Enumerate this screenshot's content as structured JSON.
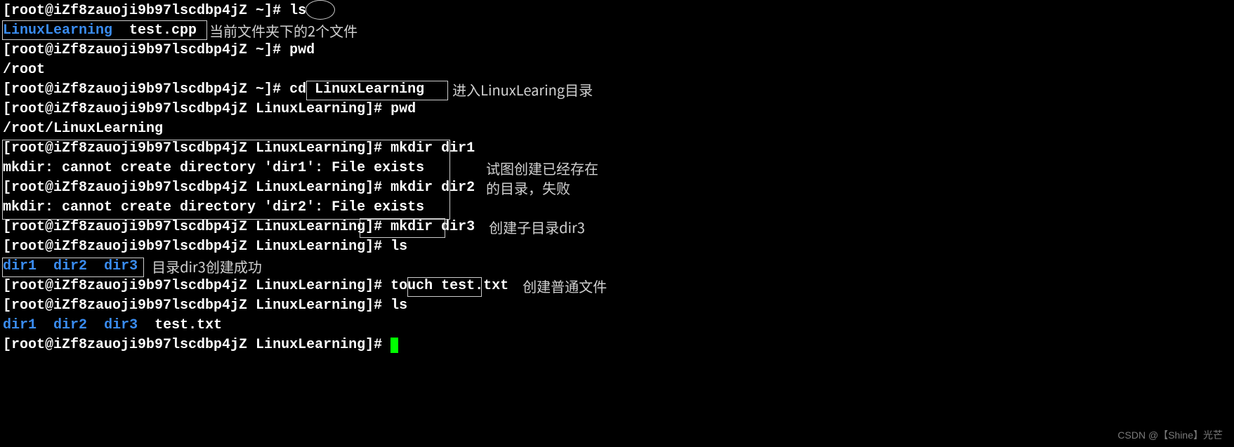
{
  "prompt_root": "[root@iZf8zauoji9b97lscdbp4jZ ~]# ",
  "prompt_linux": "[root@iZf8zauoji9b97lscdbp4jZ LinuxLearning]# ",
  "cmd_ls": "ls",
  "out_ls_dir": "LinuxLearning",
  "out_ls_file": "test.cpp",
  "annot_1": "当前文件夹下的2个文件",
  "cmd_pwd": "pwd",
  "out_pwd_root": "/root",
  "cmd_cd": "cd LinuxLearning",
  "annot_2": "进入LinuxLearing目录",
  "out_pwd_linux": "/root/LinuxLearning",
  "cmd_mkdir1": "mkdir dir1",
  "err_mkdir1": "mkdir: cannot create directory 'dir1': File exists",
  "cmd_mkdir2": "mkdir dir2",
  "err_mkdir2": "mkdir: cannot create directory 'dir2': File exists",
  "annot_3a": "试图创建已经存在",
  "annot_3b": "的目录，失败",
  "cmd_mkdir3": "mkdir dir3",
  "annot_4": "创建子目录dir3",
  "dirs_3": [
    "dir1",
    "dir2",
    "dir3"
  ],
  "annot_5": "目录dir3创建成功",
  "cmd_touch": "touch ",
  "touch_file": "test.txt",
  "annot_6": "创建普通文件",
  "ls2_file": "test.txt",
  "watermark": "CSDN @【Shine】光芒"
}
